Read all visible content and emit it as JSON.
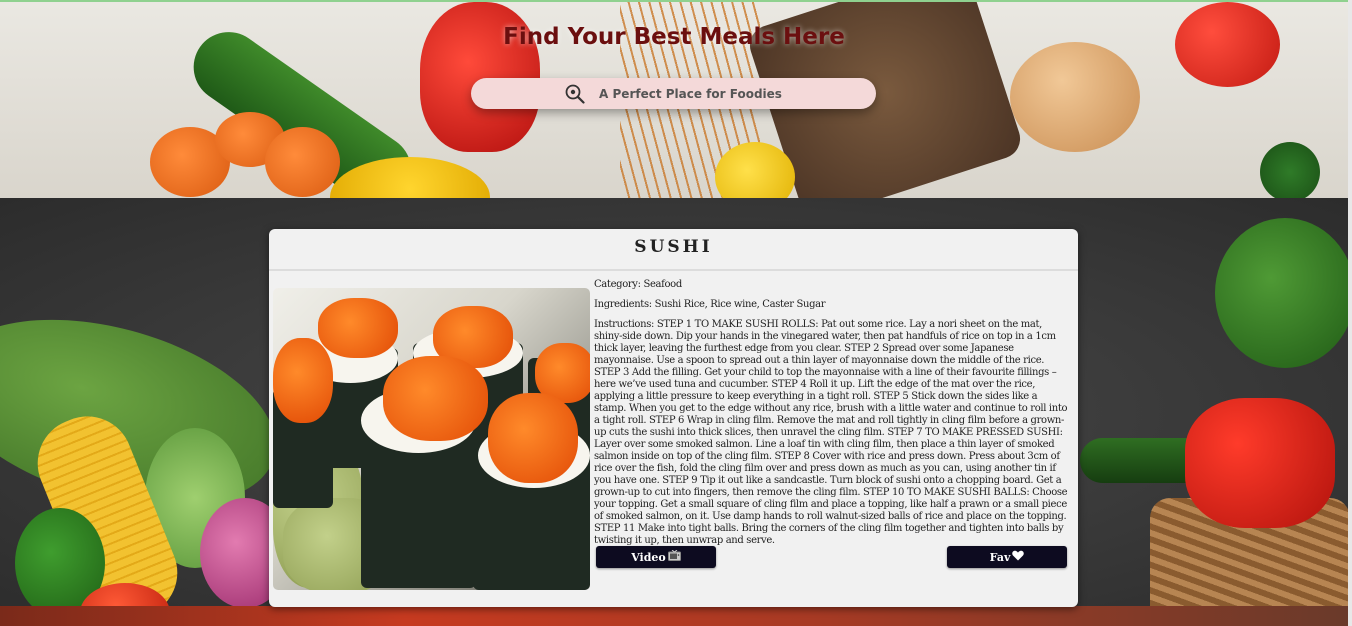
{
  "header": {
    "title": "Find Your Best Meals Here",
    "search_text": "A Perfect Place for Foodies"
  },
  "meal": {
    "name": "SUSHI",
    "category": "Category: Seafood",
    "ingredients": "Ingredients: Sushi Rice, Rice wine, Caster Sugar",
    "instructions": "Instructions: STEP 1 TO MAKE SUSHI ROLLS: Pat out some rice. Lay a nori sheet on the mat, shiny-side down. Dip your hands in the vinegared water, then pat handfuls of rice on top in a 1cm thick layer, leaving the furthest edge from you clear. STEP 2 Spread over some Japanese mayonnaise. Use a spoon to spread out a thin layer of mayonnaise down the middle of the rice. STEP 3 Add the filling. Get your child to top the mayonnaise with a line of their favourite fillings – here we’ve used tuna and cucumber. STEP 4 Roll it up. Lift the edge of the mat over the rice, applying a little pressure to keep everything in a tight roll. STEP 5 Stick down the sides like a stamp. When you get to the edge without any rice, brush with a little water and continue to roll into a tight roll. STEP 6 Wrap in cling film. Remove the mat and roll tightly in cling film before a grown-up cuts the sushi into thick slices, then unravel the cling film. STEP 7 TO MAKE PRESSED SUSHI: Layer over some smoked salmon. Line a loaf tin with cling film, then place a thin layer of smoked salmon inside on top of the cling film. STEP 8 Cover with rice and press down. Press about 3cm of rice over the fish, fold the cling film over and press down as much as you can, using another tin if you have one. STEP 9 Tip it out like a sandcastle. Turn block of sushi onto a chopping board. Get a grown-up to cut into fingers, then remove the cling film. STEP 10 TO MAKE SUSHI BALLS: Choose your topping. Get a small square of cling film and place a topping, like half a prawn or a small piece of smoked salmon, on it. Use damp hands to roll walnut-sized balls of rice and place on the topping. STEP 11 Make into tight balls. Bring the corners of the cling film together and tighten into balls by twisting it up, then unwrap and serve."
  },
  "buttons": {
    "video_label": "Video",
    "video_icon": "television-icon",
    "fav_label": "Fav",
    "fav_icon": "heart-icon"
  },
  "colors": {
    "title_color": "#6b0f0f",
    "search_bg": "#f4d9d9",
    "button_bg": "#0d0b20",
    "card_bg": "#f1f1f1"
  }
}
